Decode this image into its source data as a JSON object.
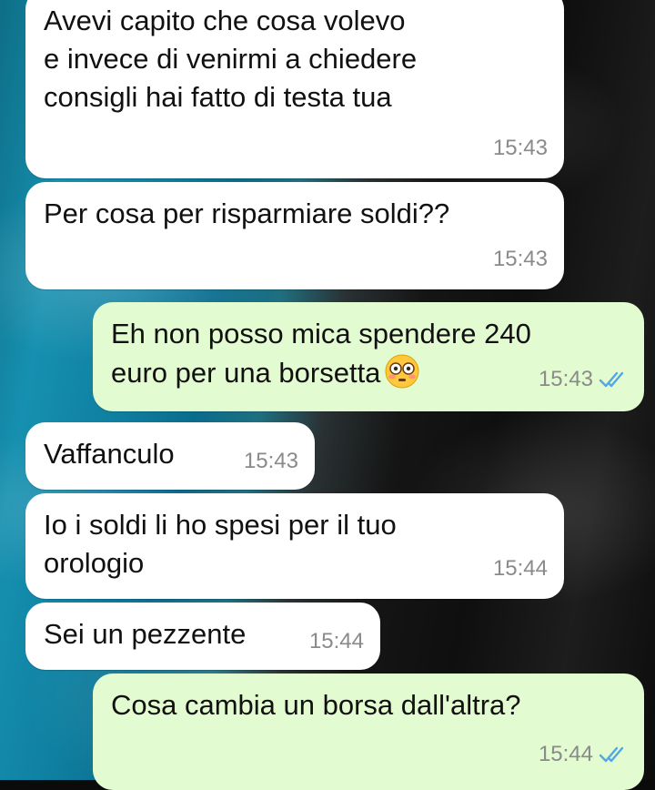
{
  "conversation": {
    "messages": [
      {
        "direction": "in",
        "text": "Avevi capito che cosa volevo\ne invece di venirmi a chiedere\nconsigli hai fatto di testa tua",
        "time": "15:43"
      },
      {
        "direction": "in",
        "text": "Per cosa per risparmiare soldi??",
        "time": "15:43"
      },
      {
        "direction": "out",
        "text": "Eh non posso mica spendere 240\neuro per una borsetta",
        "emoji": "flushed-face",
        "time": "15:43",
        "status": "read"
      },
      {
        "direction": "in",
        "text": "Vaffanculo",
        "time": "15:43"
      },
      {
        "direction": "in",
        "text": "Io i soldi li ho spesi per il tuo\norologio",
        "time": "15:44"
      },
      {
        "direction": "in",
        "text": "Sei un pezzente",
        "time": "15:44"
      },
      {
        "direction": "out",
        "text": "Cosa cambia un borsa dall'altra?",
        "time": "15:44",
        "status": "read"
      }
    ]
  },
  "colors": {
    "incoming_bubble": "#ffffff",
    "outgoing_bubble": "#e3fbd0",
    "read_ticks": "#4fa7e8",
    "timestamp": "#8a8a8a"
  },
  "icons": {
    "read_receipt": "double-check-icon",
    "emoji": "flushed-face-emoji-icon"
  }
}
